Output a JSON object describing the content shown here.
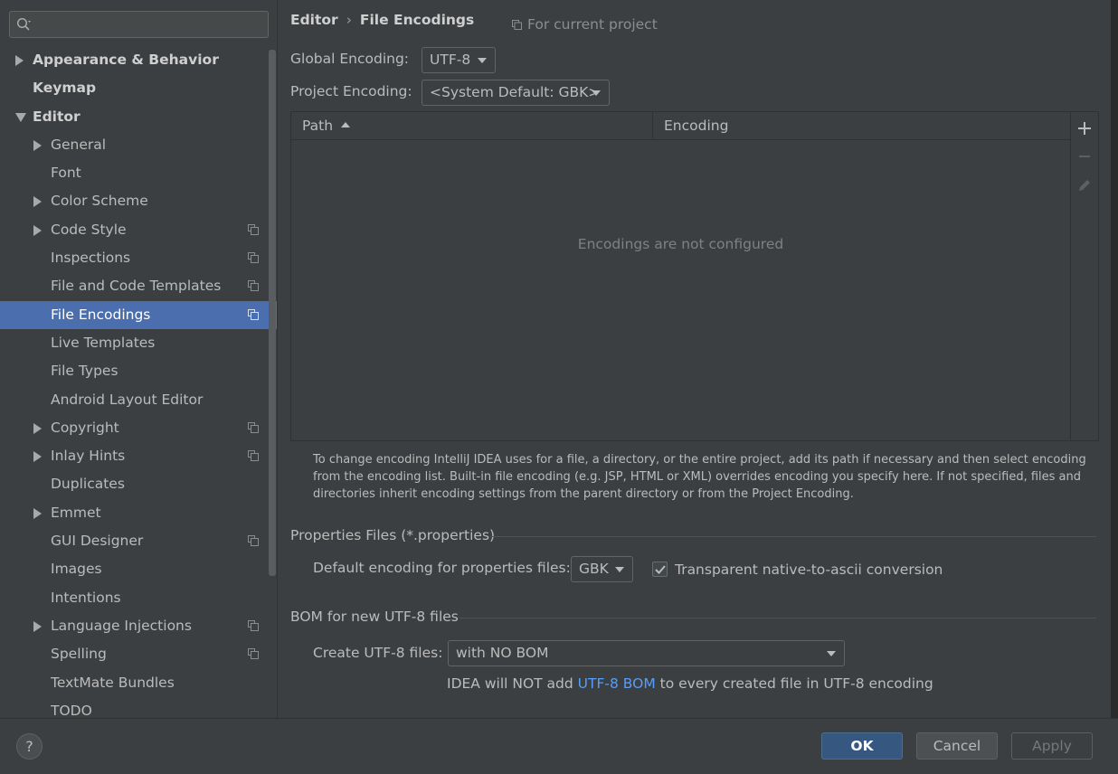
{
  "search": {
    "placeholder": ""
  },
  "sidebar": {
    "items": [
      {
        "label": "Appearance & Behavior",
        "level": 0,
        "arrow": "right",
        "bold": true,
        "project_icon": false
      },
      {
        "label": "Keymap",
        "level": 0,
        "arrow": "none",
        "bold": true,
        "project_icon": false
      },
      {
        "label": "Editor",
        "level": 0,
        "arrow": "down",
        "bold": true,
        "project_icon": false
      },
      {
        "label": "General",
        "level": 1,
        "arrow": "right",
        "bold": false,
        "project_icon": false
      },
      {
        "label": "Font",
        "level": 1,
        "arrow": "none",
        "bold": false,
        "project_icon": false
      },
      {
        "label": "Color Scheme",
        "level": 1,
        "arrow": "right",
        "bold": false,
        "project_icon": false
      },
      {
        "label": "Code Style",
        "level": 1,
        "arrow": "right",
        "bold": false,
        "project_icon": true
      },
      {
        "label": "Inspections",
        "level": 1,
        "arrow": "none",
        "bold": false,
        "project_icon": true
      },
      {
        "label": "File and Code Templates",
        "level": 1,
        "arrow": "none",
        "bold": false,
        "project_icon": true
      },
      {
        "label": "File Encodings",
        "level": 1,
        "arrow": "none",
        "bold": false,
        "project_icon": true,
        "selected": true
      },
      {
        "label": "Live Templates",
        "level": 1,
        "arrow": "none",
        "bold": false,
        "project_icon": false
      },
      {
        "label": "File Types",
        "level": 1,
        "arrow": "none",
        "bold": false,
        "project_icon": false
      },
      {
        "label": "Android Layout Editor",
        "level": 1,
        "arrow": "none",
        "bold": false,
        "project_icon": false
      },
      {
        "label": "Copyright",
        "level": 1,
        "arrow": "right",
        "bold": false,
        "project_icon": true
      },
      {
        "label": "Inlay Hints",
        "level": 1,
        "arrow": "right",
        "bold": false,
        "project_icon": true
      },
      {
        "label": "Duplicates",
        "level": 1,
        "arrow": "none",
        "bold": false,
        "project_icon": false
      },
      {
        "label": "Emmet",
        "level": 1,
        "arrow": "right",
        "bold": false,
        "project_icon": false
      },
      {
        "label": "GUI Designer",
        "level": 1,
        "arrow": "none",
        "bold": false,
        "project_icon": true
      },
      {
        "label": "Images",
        "level": 1,
        "arrow": "none",
        "bold": false,
        "project_icon": false
      },
      {
        "label": "Intentions",
        "level": 1,
        "arrow": "none",
        "bold": false,
        "project_icon": false
      },
      {
        "label": "Language Injections",
        "level": 1,
        "arrow": "right",
        "bold": false,
        "project_icon": true
      },
      {
        "label": "Spelling",
        "level": 1,
        "arrow": "none",
        "bold": false,
        "project_icon": true
      },
      {
        "label": "TextMate Bundles",
        "level": 1,
        "arrow": "none",
        "bold": false,
        "project_icon": false
      },
      {
        "label": "TODO",
        "level": 1,
        "arrow": "none",
        "bold": false,
        "project_icon": false
      }
    ]
  },
  "header": {
    "breadcrumb_root": "Editor",
    "breadcrumb_sep": "›",
    "breadcrumb_page": "File Encodings",
    "for_project": "For current project"
  },
  "encoding": {
    "global_label": "Global Encoding:",
    "global_value": "UTF-8",
    "project_label": "Project Encoding:",
    "project_value": "<System Default: GBK>"
  },
  "table": {
    "col_path": "Path",
    "col_encoding": "Encoding",
    "empty_text": "Encodings are not configured",
    "add_icon": "plus-icon",
    "remove_icon": "minus-icon",
    "edit_icon": "pencil-icon"
  },
  "help_text": "To change encoding IntelliJ IDEA uses for a file, a directory, or the entire project, add its path if necessary and then select encoding from the encoding list. Built-in file encoding (e.g. JSP, HTML or XML) overrides encoding you specify here. If not specified, files and directories inherit encoding settings from the parent directory or from the Project Encoding.",
  "properties": {
    "section_title": "Properties Files (*.properties)",
    "default_label": "Default encoding for properties files:",
    "default_value": "GBK",
    "transparent_label": "Transparent native-to-ascii conversion",
    "transparent_checked": true
  },
  "bom": {
    "section_title": "BOM for new UTF-8 files",
    "create_label": "Create UTF-8 files:",
    "create_value": "with NO BOM",
    "note_prefix": "IDEA will NOT add ",
    "note_link": "UTF-8 BOM",
    "note_suffix": " to every created file in UTF-8 encoding"
  },
  "buttons": {
    "help": "?",
    "ok": "OK",
    "cancel": "Cancel",
    "apply": "Apply"
  },
  "colors": {
    "background": "#3c3f41",
    "selection": "#4b6eaf",
    "link": "#589df6",
    "ok_button": "#365880"
  }
}
